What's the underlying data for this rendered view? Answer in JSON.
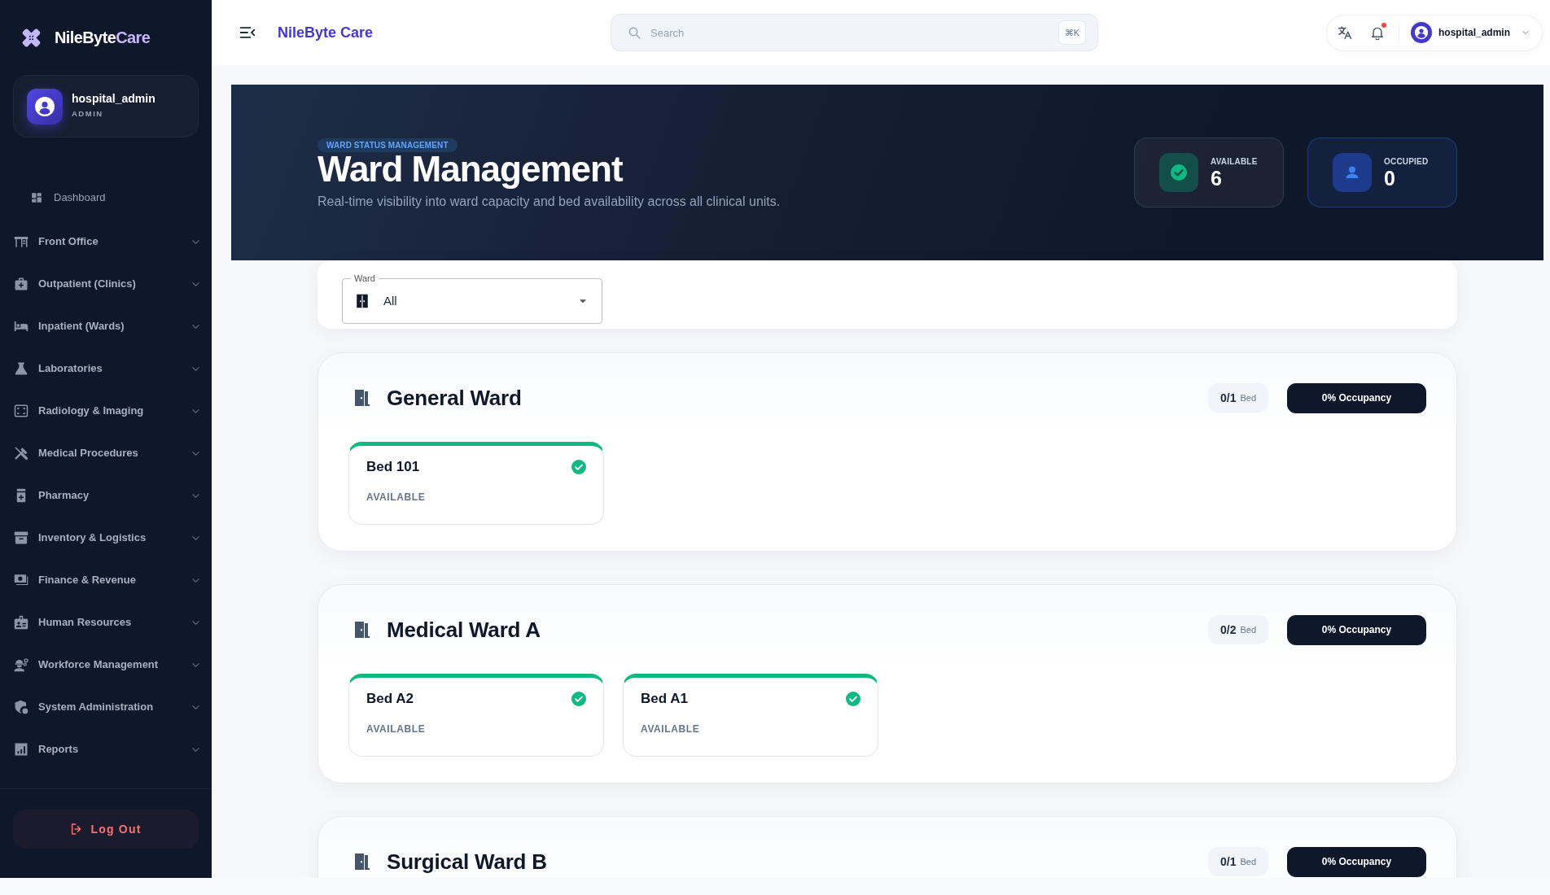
{
  "sidebar": {
    "brand": {
      "name_part": "NileByte",
      "highlighted_part": "Care"
    },
    "user": {
      "name": "hospital_admin",
      "role": "ADMIN"
    },
    "menu": [
      {
        "label": "Dashboard",
        "kind": "link"
      },
      {
        "label": "Front Office",
        "kind": "group",
        "expanded": false
      },
      {
        "label": "Outpatient (Clinics)",
        "kind": "group",
        "expanded": false
      },
      {
        "label": "Inpatient (Wards)",
        "kind": "group",
        "expanded": false
      },
      {
        "label": "Laboratories",
        "kind": "group",
        "expanded": false
      },
      {
        "label": "Radiology & Imaging",
        "kind": "group",
        "expanded": false
      },
      {
        "label": "Medical Procedures",
        "kind": "group",
        "expanded": false
      },
      {
        "label": "Pharmacy",
        "kind": "group",
        "expanded": false
      },
      {
        "label": "Inventory & Logistics",
        "kind": "group",
        "expanded": false
      },
      {
        "label": "Finance & Revenue",
        "kind": "group",
        "expanded": false
      },
      {
        "label": "Human Resources",
        "kind": "group",
        "expanded": false
      },
      {
        "label": "Workforce Management",
        "kind": "group",
        "expanded": false
      },
      {
        "label": "System Administration",
        "kind": "group",
        "expanded": false
      },
      {
        "label": "Reports",
        "kind": "group",
        "expanded": false
      }
    ],
    "logout": "Log Out"
  },
  "topbar": {
    "title": "NileByte Care",
    "search": {
      "placeholder": "Search",
      "shortcut": "⌘K"
    },
    "notifications": {
      "unread": true
    },
    "user": {
      "name": "hospital_admin"
    }
  },
  "hero": {
    "badge": "WARD STATUS MANAGEMENT",
    "title": "Ward Management",
    "subtitle": "Real-time visibility into ward capacity and bed availability across all clinical units.",
    "stats": [
      {
        "kind": "available",
        "label": "AVAILABLE",
        "value": "6"
      },
      {
        "kind": "occupied",
        "label": "OCCUPIED",
        "value": "0"
      }
    ]
  },
  "filter": {
    "label": "Ward",
    "value": "All"
  },
  "wards": [
    {
      "name": "General Ward",
      "count": "0/1",
      "unit": "Bed",
      "occupancy": "0% Occupancy",
      "beds": [
        {
          "name": "Bed 101",
          "status": "AVAILABLE",
          "kind": "available"
        }
      ]
    },
    {
      "name": "Medical Ward A",
      "count": "0/2",
      "unit": "Bed",
      "occupancy": "0% Occupancy",
      "beds": [
        {
          "name": "Bed A2",
          "status": "AVAILABLE",
          "kind": "available"
        },
        {
          "name": "Bed A1",
          "status": "AVAILABLE",
          "kind": "available"
        }
      ]
    },
    {
      "name": "Surgical Ward B",
      "count": "0/1",
      "unit": "Bed",
      "occupancy": "0% Occupancy"
    }
  ]
}
